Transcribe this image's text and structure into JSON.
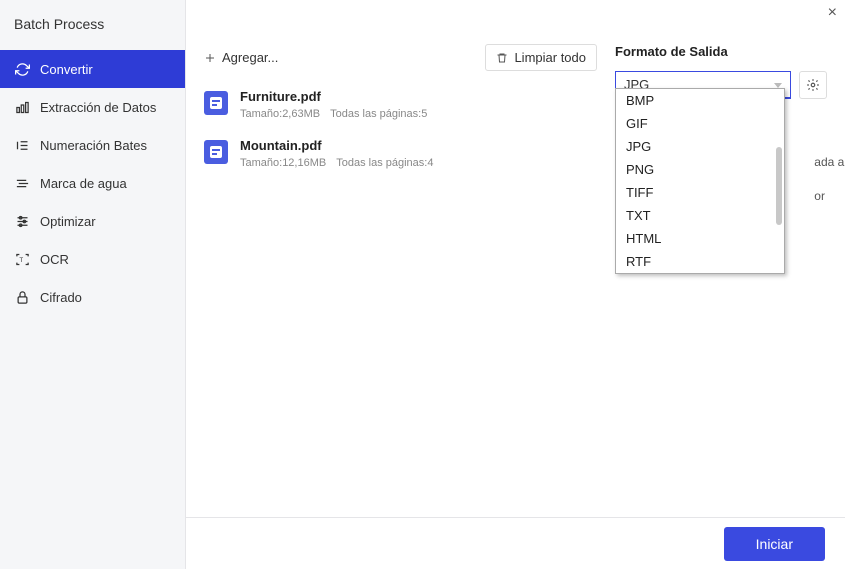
{
  "window": {
    "title": "Batch Process"
  },
  "sidebar": {
    "items": [
      {
        "label": "Convertir",
        "icon": "refresh"
      },
      {
        "label": "Extracción de Datos",
        "icon": "chart"
      },
      {
        "label": "Numeración Bates",
        "icon": "numbers"
      },
      {
        "label": "Marca de agua",
        "icon": "watermark"
      },
      {
        "label": "Optimizar",
        "icon": "sliders"
      },
      {
        "label": "OCR",
        "icon": "ocr"
      },
      {
        "label": "Cifrado",
        "icon": "lock"
      }
    ]
  },
  "toolbar": {
    "add_label": "Agregar...",
    "clear_label": "Limpiar todo"
  },
  "files": [
    {
      "name": "Furniture.pdf",
      "size_label": "Tamaño:2,63MB",
      "pages_label": "Todas las páginas:5"
    },
    {
      "name": "Mountain.pdf",
      "size_label": "Tamaño:12,16MB",
      "pages_label": "Todas las páginas:4"
    }
  ],
  "output": {
    "format_label": "Formato de Salida",
    "selected": "JPG",
    "options": [
      "BMP",
      "GIF",
      "JPG",
      "PNG",
      "TIFF",
      "TXT",
      "HTML",
      "RTF"
    ]
  },
  "hidden_panel": {
    "line1": "ada al",
    "line2": "or"
  },
  "footer": {
    "start_label": "Iniciar"
  }
}
